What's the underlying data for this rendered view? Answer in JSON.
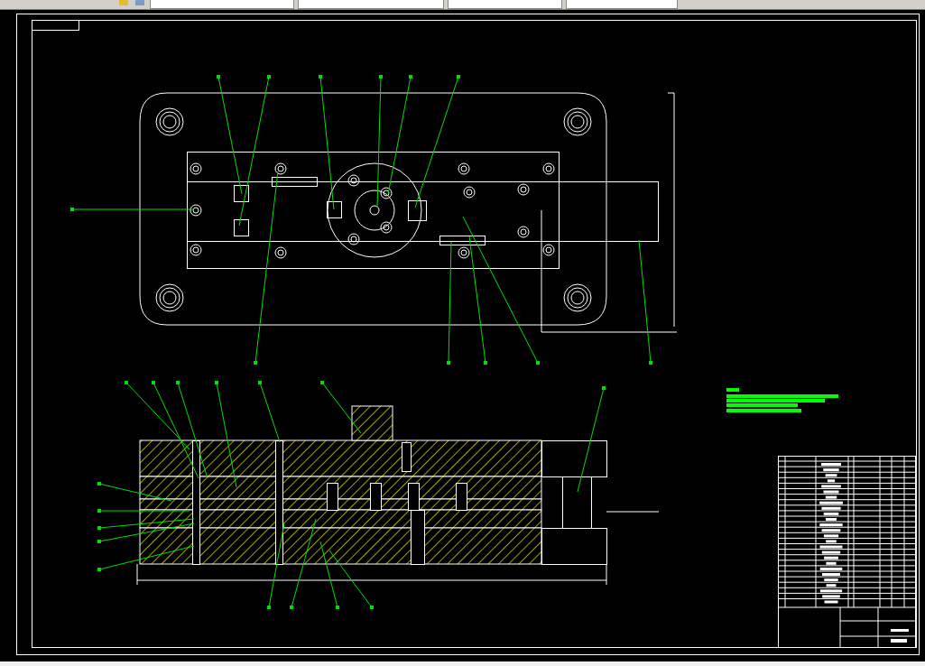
{
  "toolbar": {
    "items": [
      {
        "kind": "icon"
      },
      {
        "kind": "icon"
      },
      {
        "kind": "field"
      },
      {
        "kind": "field"
      },
      {
        "kind": "field"
      },
      {
        "kind": "field"
      }
    ]
  }
}
